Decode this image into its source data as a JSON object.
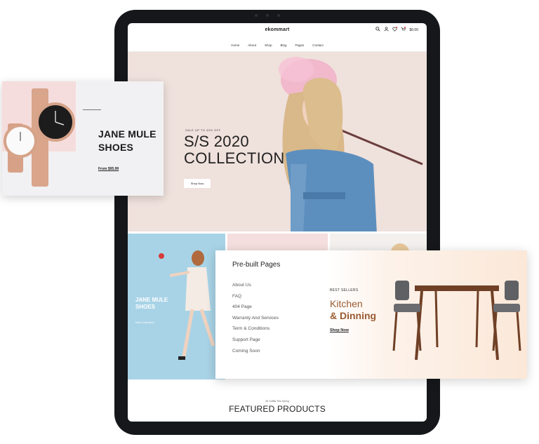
{
  "site": {
    "logo": "ekommart",
    "cart_amount": "$0.00",
    "nav": [
      "Home",
      "About",
      "Shop",
      "Blog",
      "Pages",
      "Contact"
    ],
    "icons": [
      "search-icon",
      "user-icon",
      "heart-icon",
      "cart-icon"
    ]
  },
  "hero": {
    "eyebrow": "SALE UP TO 40% OFF",
    "title_line1": "S/S 2020",
    "title_line2": "COLLECTION",
    "button": "Shop Now"
  },
  "tiles": {
    "blue_title_line1": "JANE MULE",
    "blue_title_line2": "SHOES",
    "blue_sub": "New Collection"
  },
  "featured": {
    "small": "All Outfits This Spring",
    "title": "FEATURED PRODUCTS"
  },
  "watch_card": {
    "title_line1": "JANE MULE",
    "title_line2": "SHOES",
    "price": "From $95.99"
  },
  "panel": {
    "title": "Pre-built Pages",
    "links": [
      "About Us",
      "FAQ",
      "404 Page",
      "Warranty And Services",
      "Term & Conditions",
      "Support Page",
      "Coming Soon"
    ],
    "best": "BEST SELLERS",
    "heading1": "Kitchen",
    "heading2": "& Dinning",
    "shop": "Shop Now"
  },
  "colors": {
    "hero_bg": "#efe1dc",
    "tile_blue": "#a8d3e6",
    "accent_brown": "#9a5b32"
  }
}
